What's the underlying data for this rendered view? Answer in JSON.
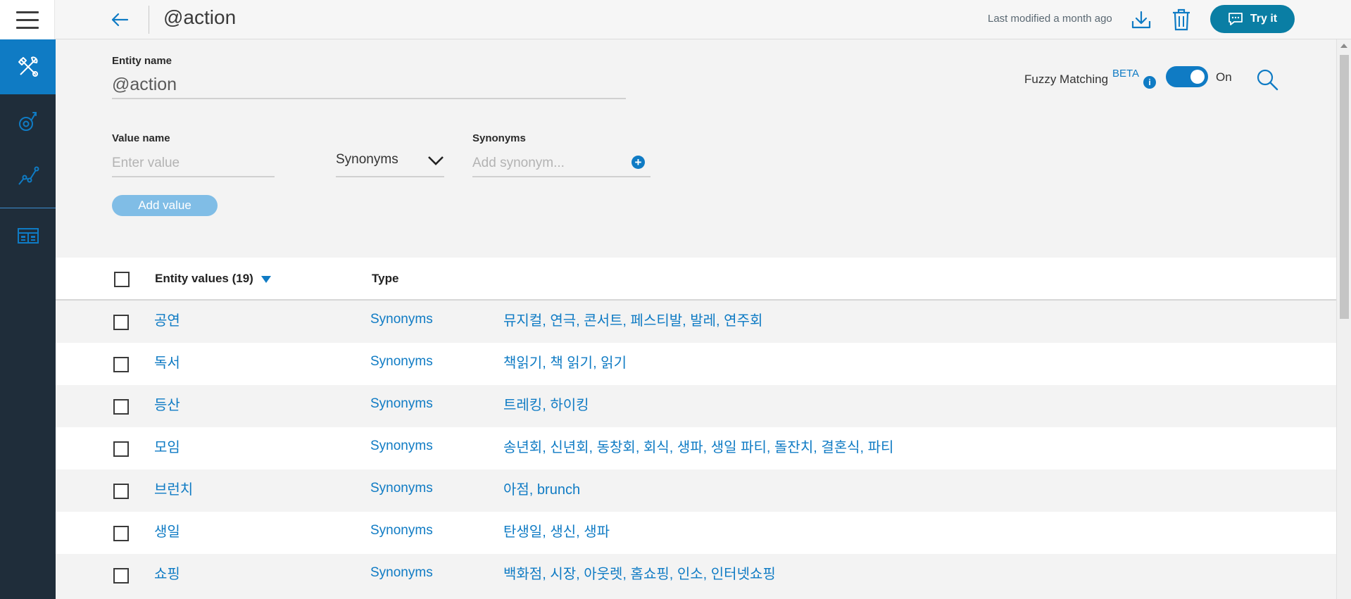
{
  "header": {
    "title": "@action",
    "last_modified": "Last modified a month ago",
    "try_it_label": "Try it"
  },
  "form": {
    "entity_name_label": "Entity name",
    "entity_name_value": "@action",
    "fuzzy_label": "Fuzzy Matching",
    "fuzzy_beta": "BETA",
    "fuzzy_info": "i",
    "fuzzy_state": "On",
    "value_name_label": "Value name",
    "value_name_placeholder": "Enter value",
    "type_selected": "Synonyms",
    "synonyms_label": "Synonyms",
    "synonyms_placeholder": "Add synonym...",
    "add_value_label": "Add value"
  },
  "table": {
    "header_values": "Entity values (19)",
    "header_type": "Type",
    "rows": [
      {
        "value": "공연",
        "type": "Synonyms",
        "synonyms": "뮤지컬, 연극, 콘서트, 페스티발, 발레, 연주회"
      },
      {
        "value": "독서",
        "type": "Synonyms",
        "synonyms": "책읽기, 책 읽기, 읽기"
      },
      {
        "value": "등산",
        "type": "Synonyms",
        "synonyms": "트레킹, 하이킹"
      },
      {
        "value": "모임",
        "type": "Synonyms",
        "synonyms": "송년회, 신년회, 동창회, 회식, 생파, 생일 파티, 돌잔치, 결혼식, 파티"
      },
      {
        "value": "브런치",
        "type": "Synonyms",
        "synonyms": "아점, brunch"
      },
      {
        "value": "생일",
        "type": "Synonyms",
        "synonyms": "탄생일, 생신, 생파"
      },
      {
        "value": "쇼핑",
        "type": "Synonyms",
        "synonyms": "백화점, 시장, 아웃렛, 홈쇼핑, 인소, 인터넷쇼핑"
      }
    ]
  },
  "icons": {
    "menu": "hamburger-menu-icon",
    "back": "arrow-left-icon",
    "download": "download-icon",
    "delete": "trash-icon",
    "chat": "chat-bubble-icon",
    "search": "search-icon",
    "sidebar": [
      "tools-icon",
      "dialog-icon",
      "analytics-icon",
      "workspaces-icon"
    ]
  },
  "colors": {
    "accent": "#0f7bc4",
    "sidebar_bg": "#1f2d3a",
    "try_it_bg": "#0a7ea4"
  }
}
